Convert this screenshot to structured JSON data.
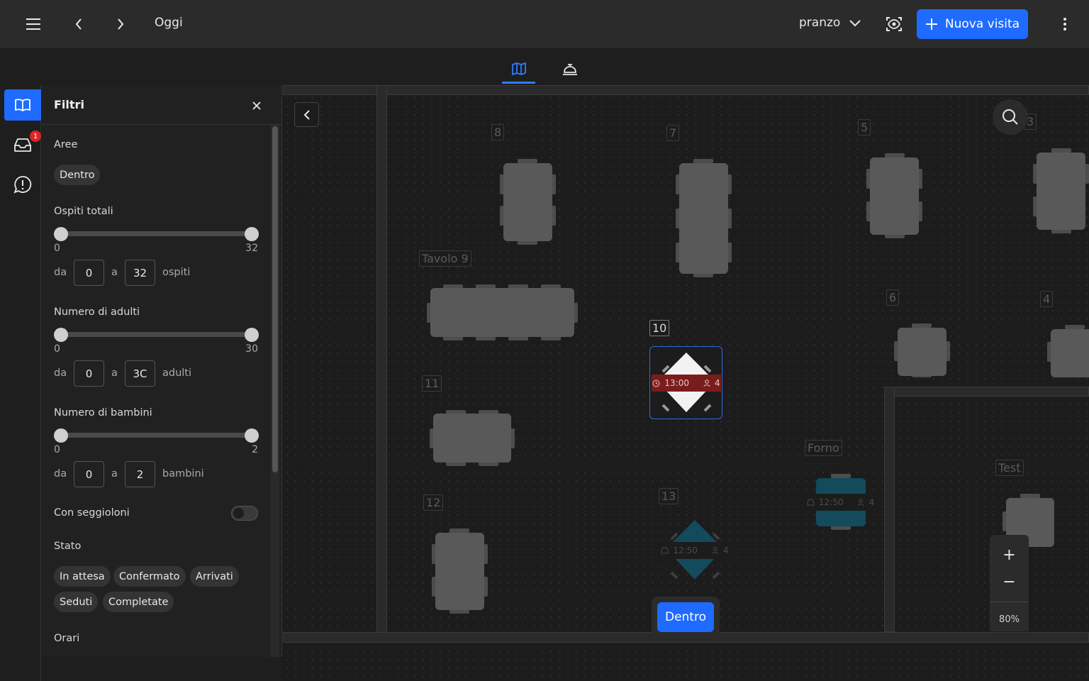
{
  "header": {
    "date_label": "Oggi",
    "service": "pranzo",
    "new_visit_label": "Nuova visita"
  },
  "rail": {
    "inbox_badge": "1"
  },
  "filters": {
    "title": "Filtri",
    "areas_label": "Aree",
    "areas": [
      "Dentro"
    ],
    "guests": {
      "label": "Ospiti totali",
      "min": "0",
      "max": "32",
      "from_label": "da",
      "to_label": "a",
      "from": "0",
      "to": "32",
      "unit": "ospiti"
    },
    "adults": {
      "label": "Numero di adulti",
      "min": "0",
      "max": "30",
      "from_label": "da",
      "to_label": "a",
      "from": "0",
      "to": "3C",
      "unit": "adulti"
    },
    "children": {
      "label": "Numero di bambini",
      "min": "0",
      "max": "2",
      "from_label": "da",
      "to_label": "a",
      "from": "0",
      "to": "2",
      "unit": "bambini"
    },
    "highchairs_label": "Con seggioloni",
    "status_label": "Stato",
    "statuses": [
      "In attesa",
      "Confermato",
      "Arrivati",
      "Seduti",
      "Completate"
    ],
    "hours_label": "Orari"
  },
  "floor": {
    "tables": {
      "t8": "8",
      "t7": "7",
      "t5": "5",
      "t3": "3",
      "t9": "Tavolo 9",
      "t6": "6",
      "t4": "4",
      "t10": "10",
      "t11": "11",
      "t12": "12",
      "t13": "13",
      "forno": "Forno",
      "test": "Test"
    },
    "reservations": {
      "r10": {
        "time": "13:00",
        "guests": "4"
      },
      "r13": {
        "time": "12:50",
        "guests": "4"
      },
      "rforno": {
        "time": "12:50",
        "guests": "4"
      }
    },
    "area_button": "Dentro",
    "zoom_level": "80%",
    "colors": {
      "accent": "#1f6bff",
      "reservation_red": "#7a1c1c",
      "reservation_teal": "#134a5c"
    }
  }
}
